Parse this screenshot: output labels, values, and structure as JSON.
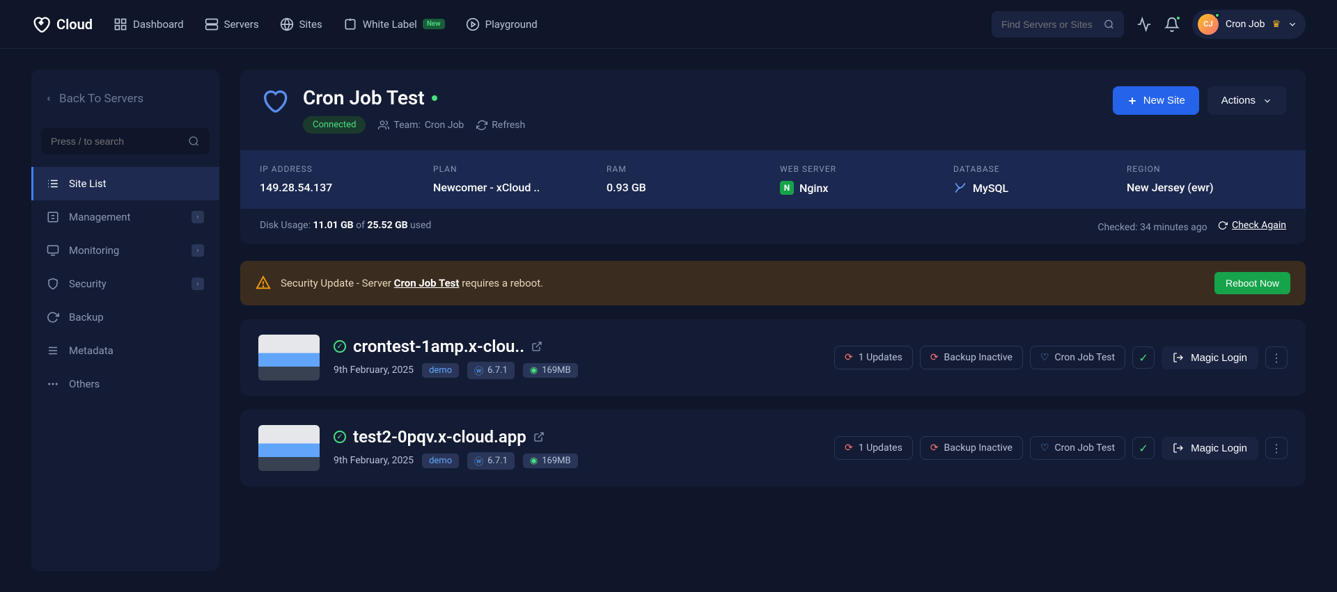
{
  "brand": "Cloud",
  "nav": {
    "dashboard": "Dashboard",
    "servers": "Servers",
    "sites": "Sites",
    "white_label": "White Label",
    "new_badge": "New",
    "playground": "Playground"
  },
  "search": {
    "placeholder": "Find Servers or Sites"
  },
  "user": {
    "name": "Cron Job",
    "initials": "CJ"
  },
  "sidebar": {
    "back": "Back To Servers",
    "search_placeholder": "Press / to search",
    "items": [
      {
        "label": "Site List"
      },
      {
        "label": "Management"
      },
      {
        "label": "Monitoring"
      },
      {
        "label": "Security"
      },
      {
        "label": "Backup"
      },
      {
        "label": "Metadata"
      },
      {
        "label": "Others"
      }
    ]
  },
  "server": {
    "name": "Cron Job Test",
    "status": "Connected",
    "team_label": "Team:",
    "team_name": "Cron Job",
    "refresh": "Refresh",
    "new_site_btn": "New Site",
    "actions_btn": "Actions"
  },
  "stats": {
    "ip_label": "IP ADDRESS",
    "ip": "149.28.54.137",
    "plan_label": "PLAN",
    "plan": "Newcomer - xCloud ..",
    "ram_label": "RAM",
    "ram": "0.93 GB",
    "web_label": "WEB SERVER",
    "web": "Nginx",
    "db_label": "DATABASE",
    "db": "MySQL",
    "region_label": "REGION",
    "region": "New Jersey (ewr)"
  },
  "disk": {
    "label": "Disk Usage: ",
    "used_val": "11.01 GB",
    "of": " of ",
    "total": "25.52 GB",
    "suffix": " used",
    "checked": "Checked: 34 minutes ago",
    "check_again": "Check Again"
  },
  "alert": {
    "prefix": "Security Update - Server ",
    "server": "Cron Job Test",
    "suffix": " requires a reboot.",
    "button": "Reboot Now"
  },
  "sites": [
    {
      "name": "crontest-1amp.x-clou..",
      "date": "9th February, 2025",
      "tag": "demo",
      "wp": "6.7.1",
      "size": "169MB",
      "updates": "1 Updates",
      "backup": "Backup Inactive",
      "team": "Cron Job Test",
      "magic": "Magic Login"
    },
    {
      "name": "test2-0pqv.x-cloud.app",
      "date": "9th February, 2025",
      "tag": "demo",
      "wp": "6.7.1",
      "size": "169MB",
      "updates": "1 Updates",
      "backup": "Backup Inactive",
      "team": "Cron Job Test",
      "magic": "Magic Login"
    }
  ]
}
